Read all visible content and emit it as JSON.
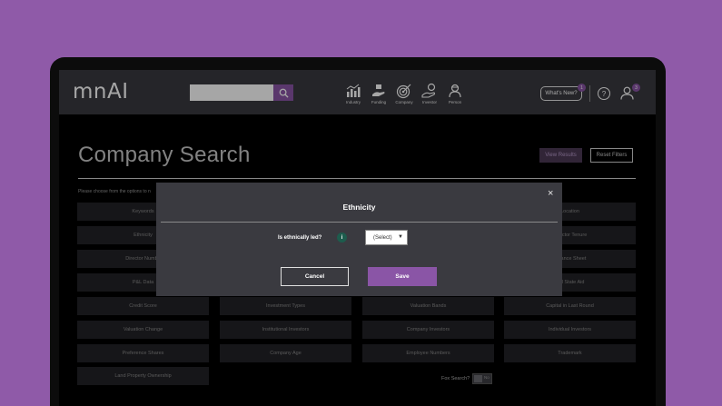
{
  "header": {
    "logo": "mnAI",
    "search": {
      "value": "",
      "placeholder": ""
    },
    "nav": [
      {
        "label": "Industry",
        "icon": "bar-chart-icon"
      },
      {
        "label": "Funding",
        "icon": "funding-icon"
      },
      {
        "label": "Company",
        "icon": "target-icon"
      },
      {
        "label": "Investor",
        "icon": "investor-icon"
      },
      {
        "label": "Person",
        "icon": "person-icon"
      }
    ],
    "whats_new": "What's New?",
    "whats_new_badge": "1",
    "help": "?",
    "user_badge": "3"
  },
  "page": {
    "title": "Company Search",
    "view_results": "View Results",
    "reset_filters": "Reset Filters",
    "instruction": "Please choose from the options to n"
  },
  "filters": [
    [
      "Keywords",
      "",
      "",
      "Location"
    ],
    [
      "Ethnicity",
      "",
      "",
      "Director Tenure"
    ],
    [
      "Director Numbe",
      "",
      "",
      "Balance Sheet"
    ],
    [
      "P&L Data",
      "",
      "",
      "cial State Aid"
    ],
    [
      "Credit Score",
      "Investment Types",
      "Valuation Bands",
      "Capital in Last Round"
    ],
    [
      "Valuation Change",
      "Institutional Investors",
      "Company Investors",
      "Individual Investors"
    ],
    [
      "Preference Shares",
      "Company Age",
      "Employee Numbers",
      "Trademark"
    ],
    [
      "Land Property Ownership",
      "",
      "",
      ""
    ]
  ],
  "fox": {
    "label": "Fox Search?",
    "toggle": "No"
  },
  "modal": {
    "title": "Ethnicity",
    "close": "×",
    "question": "Is ethnically led?",
    "info": "i",
    "select_value": "(Select)",
    "cancel": "Cancel",
    "save": "Save"
  },
  "colors": {
    "accent": "#8a55a6",
    "background": "#8f5aa8",
    "header": "#3a3a40"
  }
}
